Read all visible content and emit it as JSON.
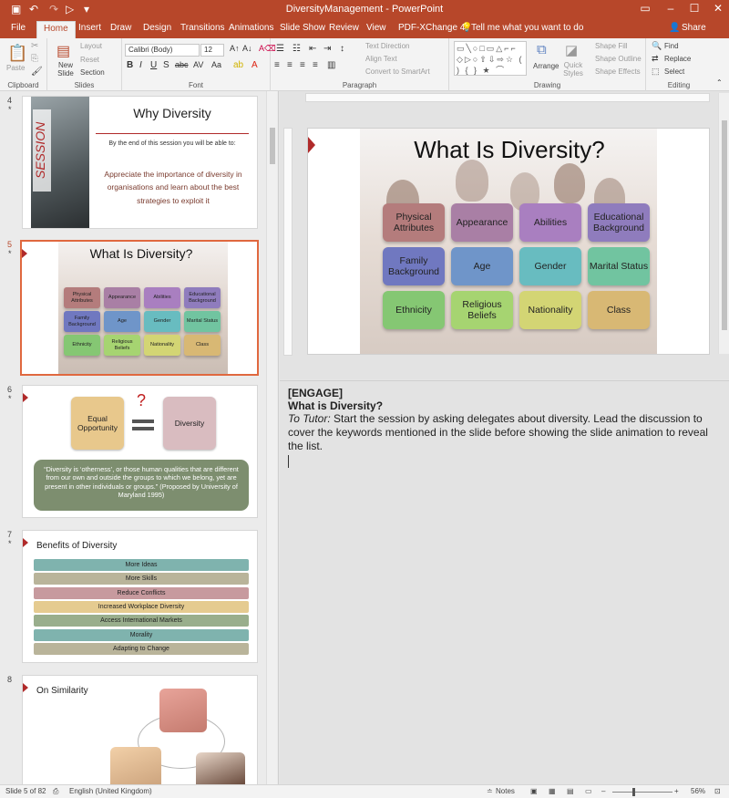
{
  "window": {
    "title": "DiversityManagement  -  PowerPoint"
  },
  "tabs": [
    "File",
    "Home",
    "Insert",
    "Draw",
    "Design",
    "Transitions",
    "Animations",
    "Slide Show",
    "Review",
    "View",
    "PDF-XChange 4"
  ],
  "tell_me": "Tell me what you want to do",
  "share": "Share",
  "ribbon": {
    "clipboard": {
      "label": "Clipboard",
      "paste": "Paste"
    },
    "slides": {
      "label": "Slides",
      "new_slide": "New Slide",
      "layout": "Layout",
      "reset": "Reset",
      "section": "Section"
    },
    "font": {
      "label": "Font",
      "font_name": "Calibri (Body)",
      "font_size": "12"
    },
    "paragraph": {
      "label": "Paragraph",
      "text_direction": "Text Direction",
      "align_text": "Align Text",
      "convert": "Convert to SmartArt"
    },
    "drawing": {
      "label": "Drawing",
      "arrange": "Arrange",
      "quick_styles": "Quick Styles",
      "shape_fill": "Shape Fill",
      "shape_outline": "Shape Outline",
      "shape_effects": "Shape Effects"
    },
    "editing": {
      "label": "Editing",
      "find": "Find",
      "replace": "Replace",
      "select": "Select"
    }
  },
  "thumbnails": {
    "s4": {
      "num": "4",
      "title": "Why Diversity",
      "side": "SESSION",
      "intro": "By the end of this session you will be able to:",
      "body": "Appreciate the importance of diversity in organisations and learn about the best strategies to exploit it"
    },
    "s5": {
      "num": "5",
      "title": "What Is Diversity?"
    },
    "s6": {
      "num": "6",
      "left": "Equal Opportunity",
      "right": "Diversity",
      "q": "?",
      "quote": "“Diversity is ‘otherness’, or those human qualities that are different from our own and outside the groups to which we belong, yet are present in other individuals or groups.” (Proposed by University of Maryland 1995)"
    },
    "s7": {
      "num": "7",
      "title": "Benefits of Diversity",
      "items": [
        "More Ideas",
        "More Skills",
        "Reduce Conflicts",
        "Increased Workplace Diversity",
        "Access International Markets",
        "Morality",
        "Adapting to Change"
      ]
    },
    "s8": {
      "num": "8",
      "title": "On Similarity"
    }
  },
  "slide": {
    "title": "What Is Diversity?",
    "tiles": [
      "Physical Attributes",
      "Appearance",
      "Abilities",
      "Educational Background",
      "Family Background",
      "Age",
      "Gender",
      "Marital Status",
      "Ethnicity",
      "Religious Beliefs",
      "Nationality",
      "Class"
    ],
    "tile_colors": [
      "#b47c7c",
      "#a97fa5",
      "#a97fc0",
      "#8f7cbd",
      "#7078c0",
      "#6f95c9",
      "#68bcc0",
      "#71c4a0",
      "#85c773",
      "#a6d471",
      "#d3d574",
      "#d8b874"
    ]
  },
  "notes": {
    "tag": "[ENGAGE]",
    "heading": "What is Diversity?",
    "lead": "To Tutor:",
    "body": " Start the session by asking delegates about diversity. Lead the discussion to cover the keywords mentioned in the slide before showing the slide animation to reveal the list."
  },
  "status": {
    "slide_count": "Slide 5 of 82",
    "language": "English (United Kingdom)",
    "notes": "Notes",
    "zoom": "56%"
  },
  "colors": {
    "accent": "#b7472a",
    "selection": "#e0683f"
  }
}
